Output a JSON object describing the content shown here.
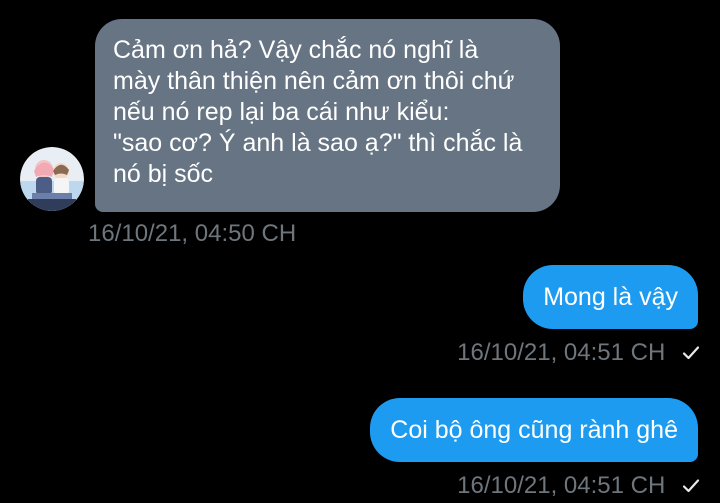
{
  "conversation": {
    "incoming": {
      "lines": [
        "Cảm ơn hả? Vậy chắc nó nghĩ là",
        "mày thân thiện nên cảm ơn thôi chứ",
        "nếu nó rep lại ba cái như kiểu:",
        "\"sao cơ? Ý anh là sao ạ?\" thì chắc là",
        "nó bị sốc"
      ],
      "timestamp": "16/10/21, 04:50 CH"
    },
    "outgoing": [
      {
        "text": "Mong là vậy",
        "timestamp": "16/10/21, 04:51 CH",
        "status_icon": "check-icon"
      },
      {
        "text": "Coi bộ ông cũng rành ghê",
        "timestamp": "16/10/21, 04:51 CH",
        "status_icon": "check-icon"
      }
    ]
  },
  "colors": {
    "background": "#000000",
    "incoming_bubble": "#667483",
    "outgoing_bubble": "#1d9bf0",
    "timestamp": "#6e767d",
    "message_text": "#ffffff"
  }
}
